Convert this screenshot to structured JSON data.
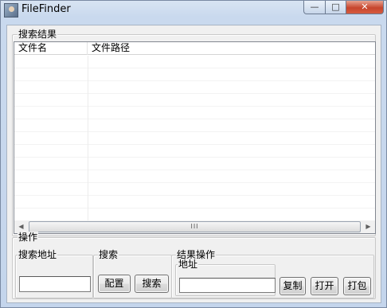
{
  "window": {
    "title": "FileFinder",
    "caption": {
      "minimize": "—",
      "maximize": "□",
      "close": "✕"
    }
  },
  "results": {
    "group_label": "搜索结果",
    "columns": [
      "文件名",
      "文件路径"
    ],
    "rows": [],
    "scrollbar": {
      "left": "◀",
      "right": "▶",
      "grip": "III"
    }
  },
  "operations": {
    "group_label": "操作",
    "search_address": {
      "label": "搜索地址",
      "value": ""
    },
    "search": {
      "label": "搜索",
      "config_button": "配置",
      "search_button": "搜索"
    },
    "result_ops": {
      "label": "结果操作",
      "address": {
        "label": "地址",
        "value": ""
      },
      "copy_button": "复制",
      "open_button": "打开",
      "pack_button": "打包"
    }
  }
}
